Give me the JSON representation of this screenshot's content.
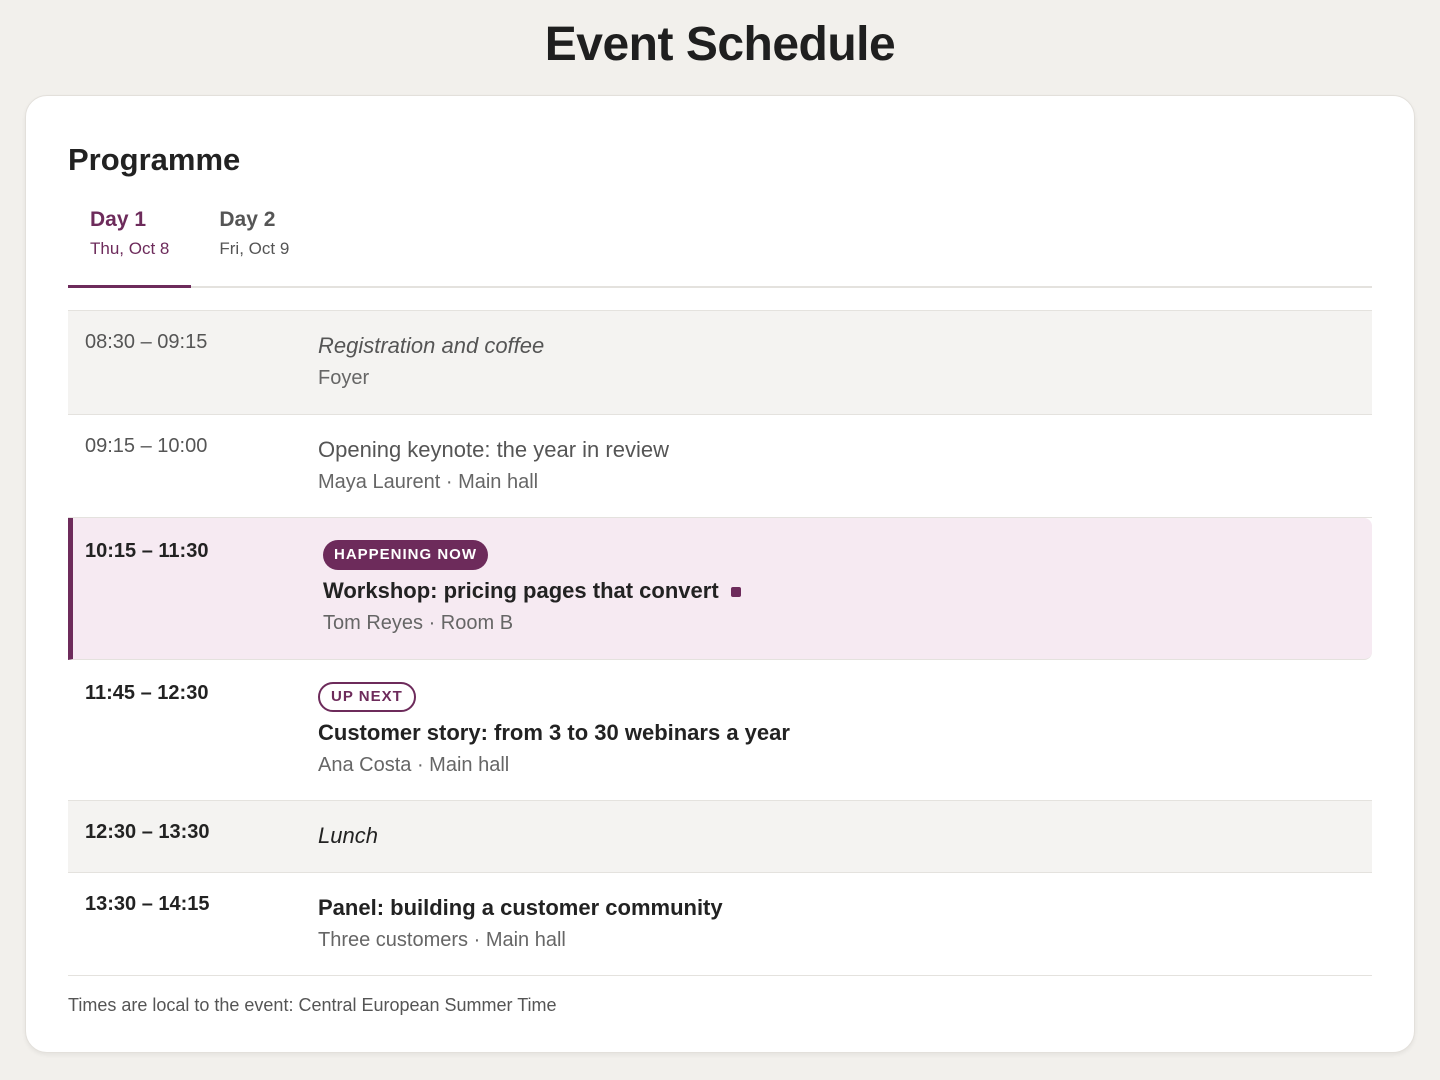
{
  "page": {
    "title": "Event Schedule"
  },
  "card": {
    "heading": "Programme"
  },
  "tabs": [
    {
      "label": "Day 1",
      "date": "Thu, Oct 8",
      "active": true
    },
    {
      "label": "Day 2",
      "date": "Fri, Oct 9",
      "active": false
    }
  ],
  "schedule": [
    {
      "time": "08:30 – 09:15",
      "title": "Registration and coffee",
      "sub": "Foyer"
    },
    {
      "time": "09:15 – 10:00",
      "title": "Opening keynote: the year in review",
      "sub": "Maya Laurent · Main hall"
    },
    {
      "time": "10:15 – 11:30",
      "badge": "HAPPENING NOW",
      "title": "Workshop: pricing pages that convert",
      "sub": "Tom Reyes · Room B"
    },
    {
      "time": "11:45 – 12:30",
      "badge": "UP NEXT",
      "title": "Customer story: from 3 to 30 webinars a year",
      "sub": "Ana Costa · Main hall"
    },
    {
      "time": "12:30 – 13:30",
      "title": "Lunch"
    },
    {
      "time": "13:30 – 14:15",
      "title": "Panel: building a customer community",
      "sub": "Three customers · Main hall"
    }
  ],
  "footnote": "Times are local to the event: Central European Summer Time",
  "colors": {
    "accent": "#6d2b5b",
    "current_bg": "#f6eaf2",
    "shaded_bg": "#f4f3f1"
  }
}
